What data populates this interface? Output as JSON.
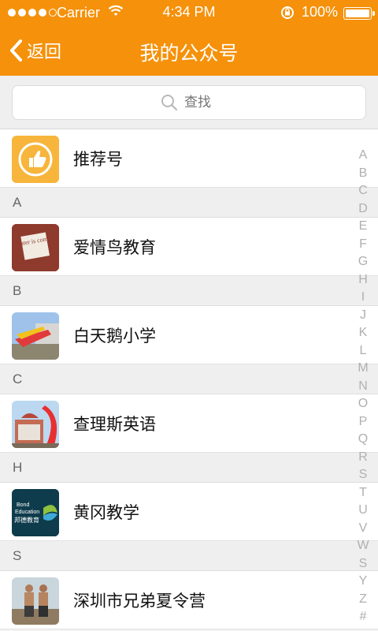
{
  "status_bar": {
    "carrier": "Carrier",
    "time": "4:34 PM",
    "battery": "100%"
  },
  "nav": {
    "back_label": "返回",
    "title": "我的公众号"
  },
  "search": {
    "placeholder": "查找"
  },
  "recommended": {
    "label": "推荐号"
  },
  "sections": [
    {
      "letter": "A",
      "item": "爱情鸟教育",
      "avatar_text": "Winter is coming"
    },
    {
      "letter": "B",
      "item": "白天鹅小学"
    },
    {
      "letter": "C",
      "item": "查理斯英语"
    },
    {
      "letter": "H",
      "item": "黄冈教学",
      "avatar_text_1": "Bond",
      "avatar_text_2": "Education",
      "avatar_text_3": "邦德教育"
    },
    {
      "letter": "S",
      "item": "深圳市兄弟夏令营"
    }
  ],
  "index_letters": [
    "A",
    "B",
    "C",
    "D",
    "E",
    "F",
    "G",
    "H",
    "I",
    "J",
    "K",
    "L",
    "M",
    "N",
    "O",
    "P",
    "Q",
    "R",
    "S",
    "T",
    "U",
    "V",
    "W",
    "S",
    "Y",
    "Z",
    "#"
  ],
  "colors": {
    "accent": "#f5910a",
    "recommend_bg": "#f7b53b"
  }
}
